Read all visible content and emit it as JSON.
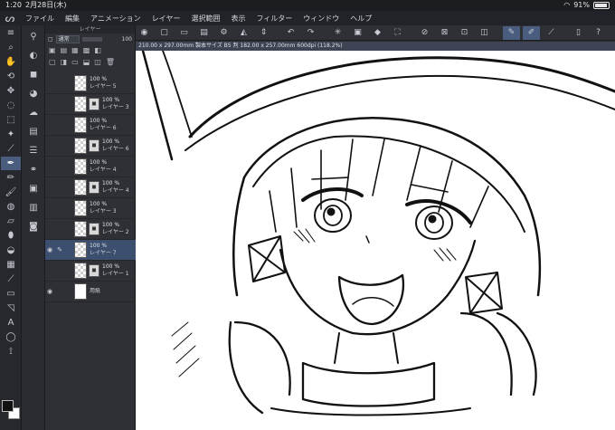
{
  "status": {
    "time": "1:20",
    "date": "2月28日(木)",
    "battery": "91%",
    "battery_level": 0.91
  },
  "menu": {
    "items": [
      "ファイル",
      "編集",
      "アニメーション",
      "レイヤー",
      "選択範囲",
      "表示",
      "フィルター",
      "ウィンドウ",
      "ヘルプ"
    ]
  },
  "layer_panel": {
    "title": "レイヤー",
    "blend_mode": "通常",
    "opacity": "100",
    "layers": [
      {
        "pct": "100 %",
        "name": "レイヤー 5",
        "selected": false,
        "visible": false
      },
      {
        "pct": "100 %",
        "name": "レイヤー 3",
        "selected": false,
        "visible": false
      },
      {
        "pct": "100 %",
        "name": "レイヤー 6",
        "selected": false,
        "visible": false
      },
      {
        "pct": "100 %",
        "name": "レイヤー 6",
        "selected": false,
        "visible": false
      },
      {
        "pct": "100 %",
        "name": "レイヤー 4",
        "selected": false,
        "visible": false
      },
      {
        "pct": "100 %",
        "name": "レイヤー 4",
        "selected": false,
        "visible": false
      },
      {
        "pct": "100 %",
        "name": "レイヤー 3",
        "selected": false,
        "visible": false
      },
      {
        "pct": "100 %",
        "name": "レイヤー 2",
        "selected": false,
        "visible": false
      },
      {
        "pct": "100 %",
        "name": "レイヤー 7",
        "selected": true,
        "visible": true
      },
      {
        "pct": "100 %",
        "name": "レイヤー 1",
        "selected": false,
        "visible": false
      },
      {
        "pct": "",
        "name": "用紙",
        "selected": false,
        "visible": true
      }
    ]
  },
  "canvas": {
    "info": "210.00 x 297.00mm 製本サイズ B5 判 182.00 x 257.00mm 600dpi (118.2%)"
  },
  "colors": {
    "accent": "#4a5d7e",
    "selected_layer": "#3c4f6e",
    "panel": "#2e3035"
  }
}
